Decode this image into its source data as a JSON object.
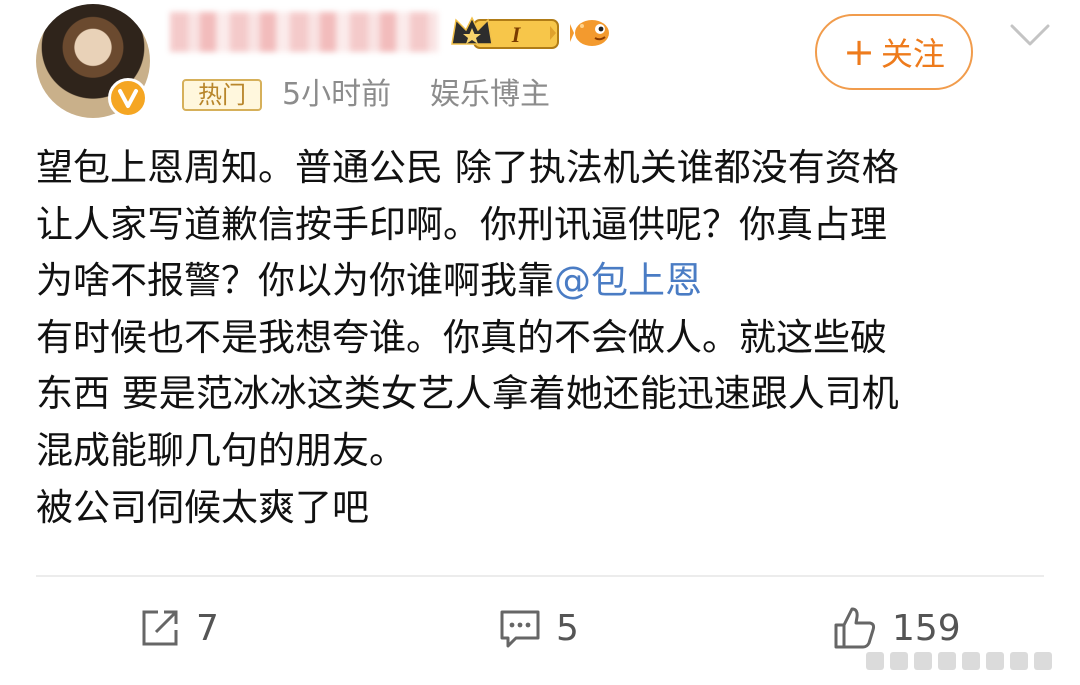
{
  "header": {
    "hot_tag": "热门",
    "time": "5小时前",
    "category": "娱乐博主",
    "vip_level": "I",
    "follow_plus": "+",
    "follow_label": "关注"
  },
  "post": {
    "lines": [
      {
        "text": "望包上恩周知。普通公民 除了执法机关谁都没有资格"
      },
      {
        "text": "让人家写道歉信按手印啊。你刑讯逼供呢？你真占理"
      },
      {
        "text": "为啥不报警？你以为你谁啊我靠",
        "mention": "@包上恩"
      },
      {
        "text": "有时候也不是我想夸谁。你真的不会做人。就这些破"
      },
      {
        "text": "东西 要是范冰冰这类女艺人拿着她还能迅速跟人司机"
      },
      {
        "text": "混成能聊几句的朋友。"
      },
      {
        "text": "被公司伺候太爽了吧"
      }
    ]
  },
  "actions": {
    "repost_count": "7",
    "comment_count": "5",
    "like_count": "159"
  },
  "icons": [
    "avatar",
    "verified-v-icon",
    "vip-crown-badge-icon",
    "fish-emoji-icon",
    "chevron-down-icon",
    "repost-icon",
    "comment-icon",
    "like-icon"
  ],
  "colors": {
    "accent_orange": "#ee7b1c",
    "mention_blue": "#4a7cc4",
    "meta_gray": "#8c8c8c",
    "hot_tag_gold": "#b8862b"
  }
}
